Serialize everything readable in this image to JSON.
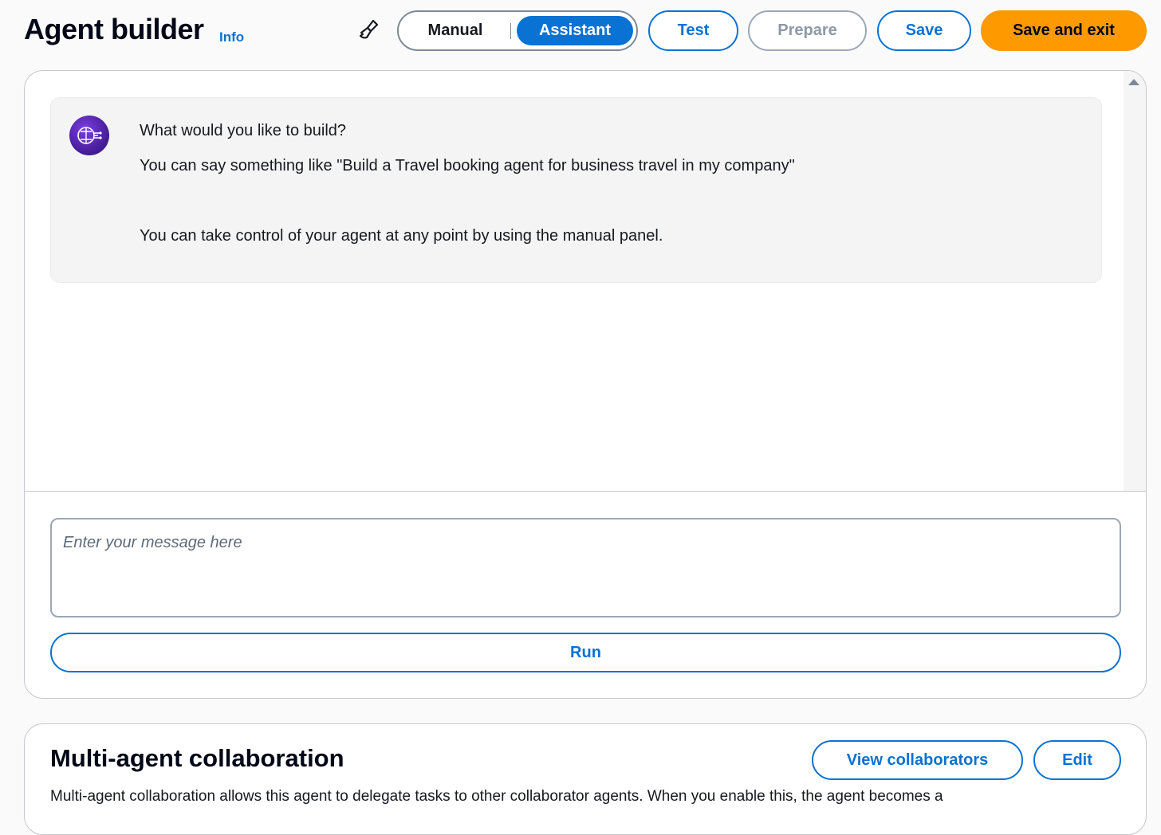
{
  "header": {
    "title": "Agent builder",
    "info_label": "Info",
    "clear_icon": "brush-icon",
    "mode_toggle": {
      "options": [
        "Manual",
        "Assistant"
      ],
      "selected": "Assistant"
    },
    "buttons": {
      "test": "Test",
      "prepare": "Prepare",
      "save": "Save",
      "save_and_exit": "Save and exit"
    }
  },
  "assistant": {
    "avatar_icon": "ai-brain-icon",
    "messages": [
      "What would you like to build?",
      "You can say something like \"Build a Travel booking agent for business travel in my company\"",
      "You can take control of your agent at any point by using the manual panel."
    ],
    "input_placeholder": "Enter your message here",
    "run_label": "Run"
  },
  "multi_agent": {
    "title": "Multi-agent collaboration",
    "view_collaborators_label": "View collaborators",
    "edit_label": "Edit",
    "description": "Multi-agent collaboration allows this agent to delegate tasks to other collaborator agents. When you enable this, the agent becomes a"
  },
  "colors": {
    "accent": "#0972d3",
    "primary_action": "#ff9900",
    "avatar": "#5a2bc0"
  }
}
